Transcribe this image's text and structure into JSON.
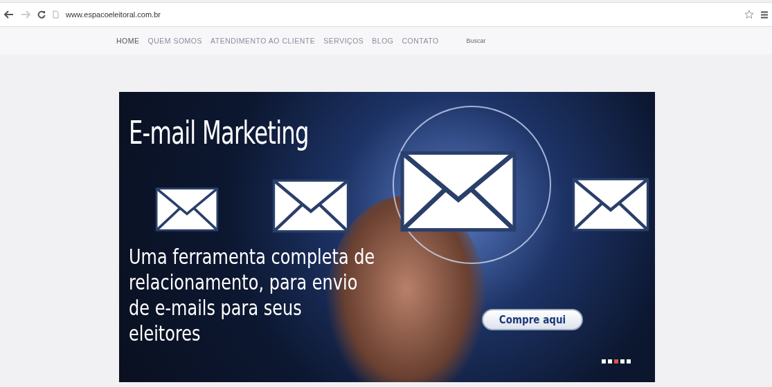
{
  "browser": {
    "url": "www.espacoeleitoral.com.br"
  },
  "nav": {
    "items": [
      {
        "label": "HOME",
        "selected": true
      },
      {
        "label": "QUEM SOMOS",
        "selected": false
      },
      {
        "label": "ATENDIMENTO AO CLIENTE",
        "selected": false
      },
      {
        "label": "SERVIÇOS",
        "selected": false
      },
      {
        "label": "BLOG",
        "selected": false
      },
      {
        "label": "CONTATO",
        "selected": false
      }
    ],
    "search": {
      "placeholder": "Buscar"
    }
  },
  "banner": {
    "title": "E-mail Marketing",
    "text": "Uma ferramenta completa de relacionamento, para envio de e-mails para seus eleitores",
    "button": "Compre aqui",
    "dots": [
      {
        "selected": false
      },
      {
        "selected": false
      },
      {
        "selected": true
      },
      {
        "selected": false
      },
      {
        "selected": false
      }
    ]
  }
}
